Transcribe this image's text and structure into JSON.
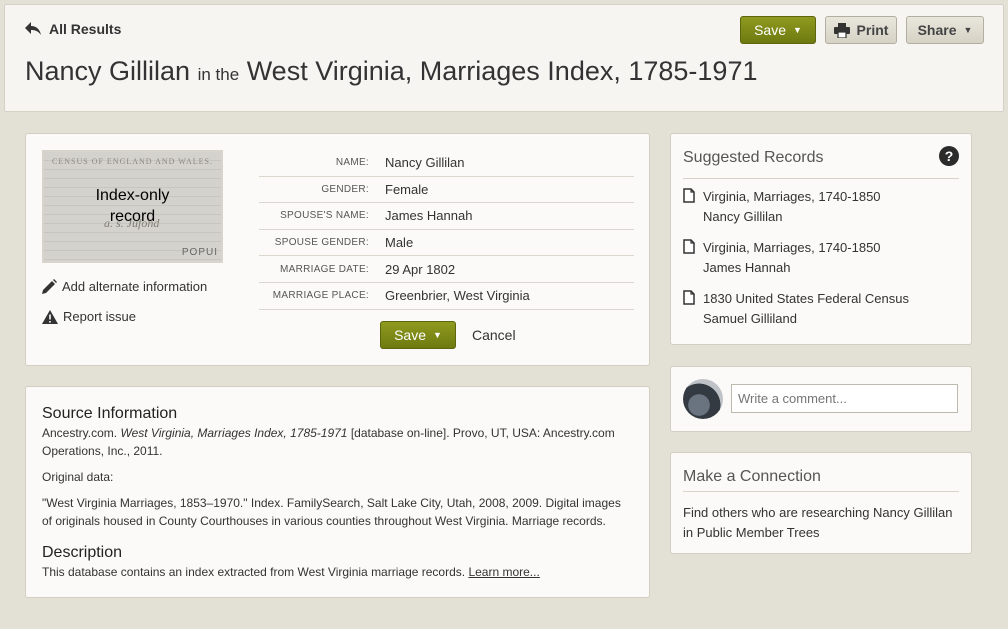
{
  "header": {
    "back_label": "All Results",
    "title_name": "Nancy Gillilan",
    "title_connector": "in the",
    "title_collection": "West Virginia, Marriages Index, 1785-1971",
    "save_label": "Save",
    "print_label": "Print",
    "share_label": "Share"
  },
  "record": {
    "thumbnail_label_line1": "Index-only",
    "thumbnail_label_line2": "record",
    "add_alternate_label": "Add alternate information",
    "report_issue_label": "Report issue",
    "fields": [
      {
        "label": "NAME:",
        "value": "Nancy Gillilan"
      },
      {
        "label": "GENDER:",
        "value": "Female"
      },
      {
        "label": "SPOUSE'S NAME:",
        "value": "James Hannah"
      },
      {
        "label": "SPOUSE GENDER:",
        "value": "Male"
      },
      {
        "label": "MARRIAGE DATE:",
        "value": "29 Apr 1802"
      },
      {
        "label": "MARRIAGE PLACE:",
        "value": "Greenbrier, West Virginia"
      }
    ],
    "save_label": "Save",
    "cancel_label": "Cancel"
  },
  "source": {
    "heading": "Source Information",
    "citation_prefix": "Ancestry.com. ",
    "citation_title": "West Virginia, Marriages Index, 1785-1971",
    "citation_suffix": " [database on-line]. Provo, UT, USA: Ancestry.com Operations, Inc., 2011.",
    "original_data_label": "Original data:",
    "original_data_text": "\"West Virginia Marriages, 1853–1970.\" Index. FamilySearch, Salt Lake City, Utah, 2008, 2009. Digital images of originals housed in County Courthouses in various counties throughout West Virginia. Marriage records.",
    "description_heading": "Description",
    "description_text": "This database contains an index extracted from West Virginia marriage records. ",
    "learn_more_label": "Learn more..."
  },
  "suggested": {
    "title": "Suggested Records",
    "items": [
      {
        "title": "Virginia, Marriages, 1740-1850",
        "person": "Nancy Gillilan"
      },
      {
        "title": "Virginia, Marriages, 1740-1850",
        "person": "James Hannah"
      },
      {
        "title": "1830 United States Federal Census",
        "person": "Samuel Gilliland"
      }
    ]
  },
  "comment": {
    "placeholder": "Write a comment..."
  },
  "connection": {
    "title": "Make a Connection",
    "text": "Find others who are researching Nancy Gillilan in Public Member Trees"
  }
}
